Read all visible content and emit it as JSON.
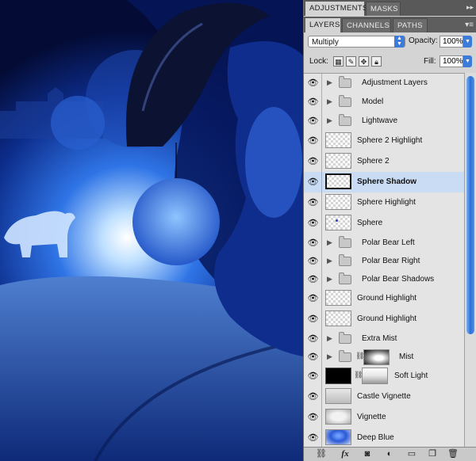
{
  "tabs_top": [
    {
      "label": "ADJUSTMENTS",
      "active": true
    },
    {
      "label": "MASKS",
      "active": false
    }
  ],
  "tabs_layers": [
    {
      "label": "LAYERS",
      "active": true
    },
    {
      "label": "CHANNELS",
      "active": false
    },
    {
      "label": "PATHS",
      "active": false
    }
  ],
  "blend_mode": "Multiply",
  "opacity_label": "Opacity:",
  "opacity_value": "100%",
  "lock_label": "Lock:",
  "fill_label": "Fill:",
  "fill_value": "100%",
  "layers": [
    {
      "name": "Adjustment Layers",
      "type": "group",
      "selected": false
    },
    {
      "name": "Model",
      "type": "group",
      "selected": false
    },
    {
      "name": "Lightwave",
      "type": "group",
      "selected": false
    },
    {
      "name": "Sphere 2 Highlight",
      "type": "layer",
      "selected": false
    },
    {
      "name": "Sphere 2",
      "type": "layer",
      "selected": false
    },
    {
      "name": "Sphere Shadow",
      "type": "layer",
      "selected": true
    },
    {
      "name": "Sphere Highlight",
      "type": "layer",
      "selected": false
    },
    {
      "name": "Sphere",
      "type": "layer",
      "selected": false
    },
    {
      "name": "Polar Bear Left",
      "type": "group",
      "selected": false
    },
    {
      "name": "Polar Bear Right",
      "type": "group",
      "selected": false
    },
    {
      "name": "Polar Bear Shadows",
      "type": "group",
      "selected": false
    },
    {
      "name": "Ground Highlight",
      "type": "layer",
      "selected": false
    },
    {
      "name": "Ground Highlight",
      "type": "layer",
      "selected": false
    },
    {
      "name": "Extra Mist",
      "type": "group",
      "selected": false
    },
    {
      "name": "Mist",
      "type": "group-mask",
      "selected": false
    },
    {
      "name": "Soft Light",
      "type": "adjust-mask",
      "selected": false
    },
    {
      "name": "Castle Vignette",
      "type": "layer",
      "selected": false
    },
    {
      "name": "Vignette",
      "type": "layer",
      "selected": false
    },
    {
      "name": "Deep Blue",
      "type": "layer",
      "selected": false
    }
  ],
  "bottom_icons": [
    "link-icon",
    "fx-icon",
    "mask-icon",
    "adjustment-icon",
    "folder-icon",
    "new-layer-icon",
    "trash-icon"
  ],
  "colors": {
    "accent": "#3d7bd8",
    "selection": "#c9dcf4",
    "panel": "#d4d4d4"
  }
}
